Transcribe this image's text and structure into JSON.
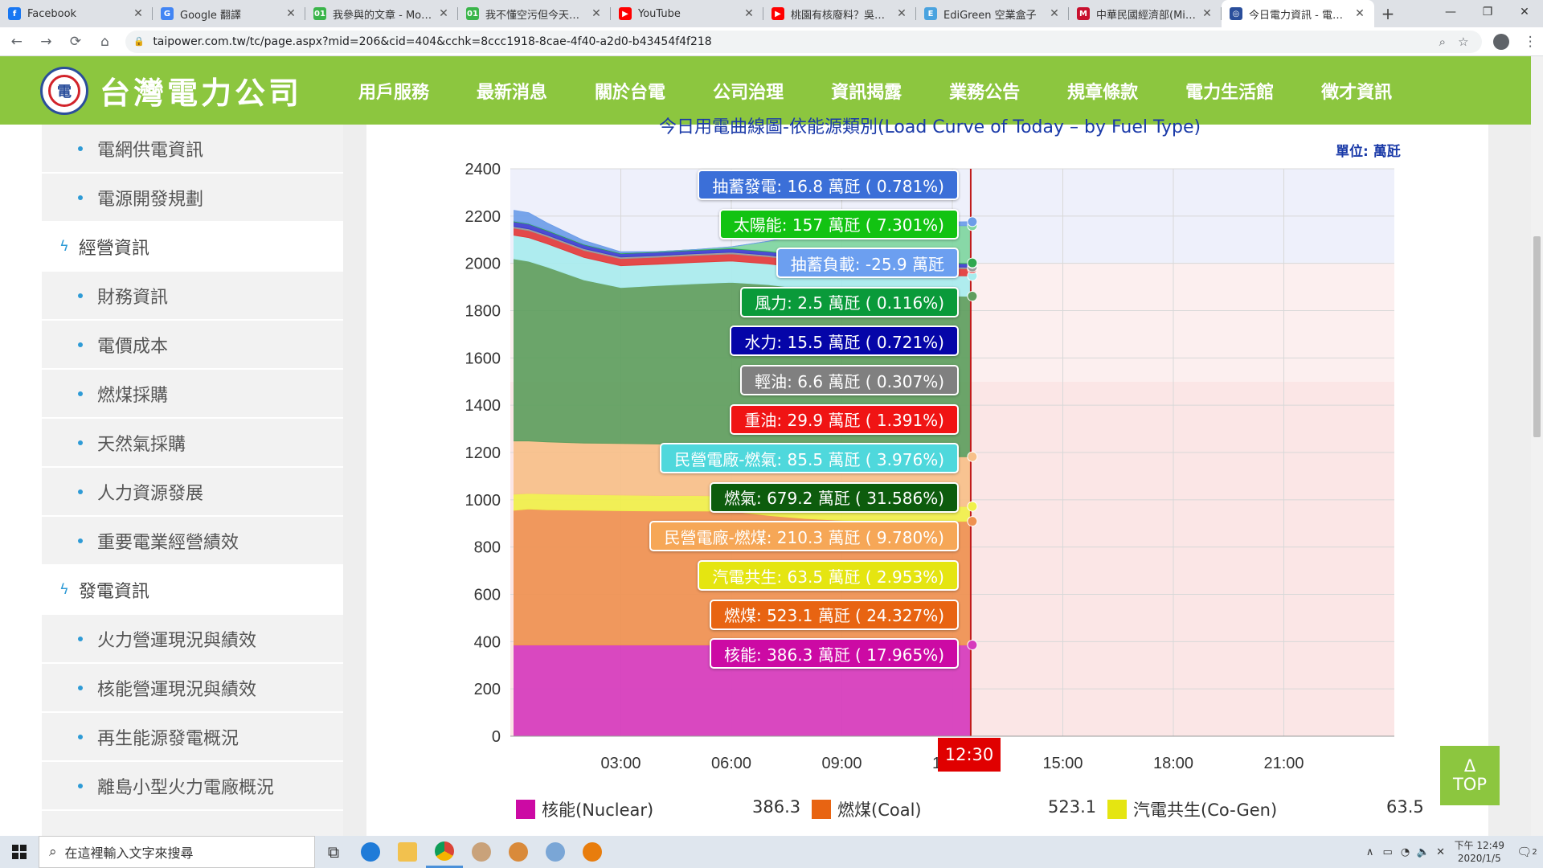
{
  "tabs": [
    {
      "label": "Facebook",
      "color": "#1877f2",
      "glyph": "f"
    },
    {
      "label": "Google 翻譯",
      "color": "#4285f4",
      "glyph": "G"
    },
    {
      "label": "我參與的文章 - Mobile",
      "color": "#3ab54a",
      "glyph": "01"
    },
    {
      "label": "我不懂空污但今天的天",
      "color": "#3ab54a",
      "glyph": "01"
    },
    {
      "label": "YouTube",
      "color": "#ff0000",
      "glyph": "▶"
    },
    {
      "label": "桃園有核廢料？吳志揚",
      "color": "#ff0000",
      "glyph": "▶"
    },
    {
      "label": "EdiGreen 空業盒子",
      "color": "#4aa3df",
      "glyph": "E"
    },
    {
      "label": "中華民國經濟部(Minist",
      "color": "#c8102e",
      "glyph": "M"
    },
    {
      "label": "今日電力資訊 - 電力供",
      "color": "#2a4e9b",
      "glyph": "◎"
    }
  ],
  "browser": {
    "url": "taipower.com.tw/tc/page.aspx?mid=206&cid=404&cchk=8ccc1918-8cae-4f40-a2d0-b43454f4f218",
    "new_tab": "+",
    "back": "←",
    "forward": "→",
    "reload": "⟳",
    "home": "⌂"
  },
  "site": {
    "name": "台灣電力公司",
    "logo_glyph": "電",
    "nav": [
      "用戶服務",
      "最新消息",
      "關於台電",
      "公司治理",
      "資訊揭露",
      "業務公告",
      "規章條款",
      "電力生活館",
      "徵才資訊"
    ]
  },
  "sidebar": [
    {
      "label": "電網供電資訊",
      "kind": "sub"
    },
    {
      "label": "電源開發規劃",
      "kind": "sub"
    },
    {
      "label": "經營資訊",
      "kind": "group"
    },
    {
      "label": "財務資訊",
      "kind": "sub"
    },
    {
      "label": "電價成本",
      "kind": "sub"
    },
    {
      "label": "燃煤採購",
      "kind": "sub"
    },
    {
      "label": "天然氣採購",
      "kind": "sub"
    },
    {
      "label": "人力資源發展",
      "kind": "sub"
    },
    {
      "label": "重要電業經營績效",
      "kind": "sub"
    },
    {
      "label": "發電資訊",
      "kind": "group"
    },
    {
      "label": "火力營運現況與績效",
      "kind": "sub"
    },
    {
      "label": "核能營運現況與績效",
      "kind": "sub"
    },
    {
      "label": "再生能源發電概況",
      "kind": "sub"
    },
    {
      "label": "離島小型火力電廠概況",
      "kind": "sub"
    }
  ],
  "chart_header": {
    "title": "今日用電曲線圖-依能源類別(Load Curve of Today – by Fuel Type)",
    "unit": "單位: 萬瓩"
  },
  "chart_data": {
    "type": "area",
    "ylim": [
      0,
      2400
    ],
    "yticks": [
      0,
      200,
      400,
      600,
      800,
      1000,
      1200,
      1400,
      1600,
      1800,
      2000,
      2200,
      2400
    ],
    "xlim": [
      0,
      24
    ],
    "xticks": [
      "03:00",
      "06:00",
      "09:00",
      "12:00",
      "15:00",
      "18:00",
      "21:00"
    ],
    "xtick_hours": [
      3,
      6,
      9,
      12,
      15,
      18,
      21
    ],
    "current_time": "12:30",
    "current_hour": 12.5,
    "bands": [
      {
        "from": 0,
        "to": 1500,
        "color": "#fbe6e6"
      },
      {
        "from": 1500,
        "to": 2000,
        "color": "#fcefef"
      },
      {
        "from": 2000,
        "to": 2400,
        "color": "#eef0fb"
      }
    ],
    "x_hours": [
      0.1,
      0.5,
      1,
      2,
      3,
      4,
      5,
      6,
      7,
      8,
      9,
      10,
      11,
      12,
      12.5
    ],
    "series": [
      {
        "name": "核能(Nuclear)",
        "color": "#d63bbd",
        "values": [
          386,
          386,
          386,
          386,
          386,
          386,
          386,
          386,
          386,
          386,
          386,
          386,
          386,
          386,
          386
        ]
      },
      {
        "name": "燃煤(Coal)",
        "color": "#ef9151",
        "values": [
          570,
          575,
          572,
          570,
          568,
          567,
          567,
          566,
          548,
          535,
          527,
          525,
          524,
          523,
          523
        ]
      },
      {
        "name": "汽電共生(Co-Gen)",
        "color": "#f0f04a",
        "values": [
          68,
          66,
          67,
          66,
          66,
          65,
          65,
          64,
          64,
          64,
          64,
          64,
          64,
          63,
          63
        ]
      },
      {
        "name": "民營電廠-燃煤",
        "color": "#f7c08a",
        "values": [
          225,
          222,
          220,
          218,
          218,
          218,
          216,
          214,
          212,
          212,
          211,
          211,
          210,
          210,
          210
        ]
      },
      {
        "name": "燃氣",
        "color": "#5e9e5e",
        "values": [
          770,
          760,
          740,
          690,
          660,
          670,
          680,
          690,
          700,
          695,
          690,
          688,
          685,
          680,
          679
        ]
      },
      {
        "name": "民營電廠-燃氣",
        "color": "#a8ecee",
        "values": [
          100,
          100,
          98,
          95,
          92,
          90,
          90,
          90,
          88,
          88,
          87,
          86,
          86,
          86,
          86
        ]
      },
      {
        "name": "重油",
        "color": "#e23b3b",
        "values": [
          30,
          30,
          30,
          30,
          30,
          30,
          30,
          30,
          30,
          30,
          30,
          30,
          30,
          30,
          30
        ]
      },
      {
        "name": "輕油",
        "color": "#9a9a9a",
        "values": [
          7,
          7,
          7,
          7,
          7,
          7,
          7,
          7,
          7,
          7,
          7,
          7,
          7,
          7,
          7
        ]
      },
      {
        "name": "水力",
        "color": "#3e3ecf",
        "values": [
          20,
          20,
          18,
          16,
          14,
          14,
          14,
          15,
          15,
          15,
          15,
          15,
          15,
          15,
          15
        ]
      },
      {
        "name": "風力",
        "color": "#2fa84f",
        "values": [
          3,
          3,
          3,
          3,
          3,
          3,
          3,
          3,
          3,
          3,
          3,
          3,
          3,
          3,
          3
        ]
      },
      {
        "name": "太陽能",
        "color": "#7fd6a0",
        "values": [
          0,
          0,
          0,
          0,
          0,
          0,
          0,
          5,
          40,
          90,
          130,
          150,
          156,
          157,
          157
        ]
      },
      {
        "name": "抽蓄發電",
        "color": "#6d9de8",
        "values": [
          45,
          45,
          30,
          15,
          5,
          0,
          0,
          0,
          0,
          0,
          0,
          0,
          5,
          15,
          17
        ]
      }
    ],
    "tooltip": [
      {
        "text": "抽蓄發電: 16.8 萬瓩 ( 0.781%)",
        "color": "#3b6fd8"
      },
      {
        "text": "太陽能: 157 萬瓩 ( 7.301%)",
        "color": "#12c312"
      },
      {
        "text": "抽蓄負載: -25.9 萬瓩",
        "color": "#6c9ff0"
      },
      {
        "text": "風力: 2.5 萬瓩 ( 0.116%)",
        "color": "#0a9a3a"
      },
      {
        "text": "水力: 15.5 萬瓩 ( 0.721%)",
        "color": "#0505a8"
      },
      {
        "text": "輕油: 6.6 萬瓩 ( 0.307%)",
        "color": "#808080"
      },
      {
        "text": "重油: 29.9 萬瓩 ( 1.391%)",
        "color": "#f01414"
      },
      {
        "text": "民營電廠-燃氣: 85.5 萬瓩 ( 3.976%)",
        "color": "#4fd8dc"
      },
      {
        "text": "燃氣: 679.2 萬瓩 ( 31.586%)",
        "color": "#0d5c0d"
      },
      {
        "text": "民營電廠-燃煤: 210.3 萬瓩 ( 9.780%)",
        "color": "#f6a757"
      },
      {
        "text": "汽電共生: 63.5 萬瓩 ( 2.953%)",
        "color": "#e5e511"
      },
      {
        "text": "燃煤: 523.1 萬瓩 ( 24.327%)",
        "color": "#e86412"
      },
      {
        "text": "核能: 386.3 萬瓩 ( 17.965%)",
        "color": "#cc0aa4"
      }
    ],
    "legend": [
      {
        "label": "核能(Nuclear)",
        "value": "386.3",
        "color": "#cc0aa4"
      },
      {
        "label": "燃煤(Coal)",
        "value": "523.1",
        "color": "#e86412"
      },
      {
        "label": "汽電共生(Co-Gen)",
        "value": "63.5",
        "color": "#e5e511"
      }
    ]
  },
  "top_button": {
    "arrow": "Δ",
    "label": "TOP"
  },
  "taskbar": {
    "search_placeholder": "在這裡輸入文字來搜尋",
    "time": "下午 12:49",
    "date": "2020/1/5",
    "notif_count": "2"
  }
}
